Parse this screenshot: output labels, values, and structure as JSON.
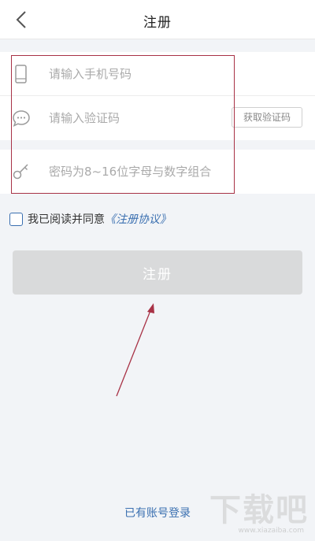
{
  "header": {
    "title": "注册"
  },
  "form": {
    "phone_placeholder": "请输入手机号码",
    "code_placeholder": "请输入验证码",
    "get_code_label": "获取验证码",
    "password_placeholder": "密码为8~16位字母与数字组合"
  },
  "agreement": {
    "text": "我已阅读并同意",
    "link": "《注册协议》",
    "checked": false
  },
  "register_button": {
    "label": "注册"
  },
  "login_link": "已有账号登录",
  "watermark": {
    "text": "下载吧",
    "url": "www.xiazaiba.com"
  },
  "icons": [
    "back-arrow-icon",
    "phone-icon",
    "chat-bubble-icon",
    "key-icon"
  ],
  "colors": {
    "accent": "#3a6fb0",
    "highlight": "#a83246",
    "disabled_button": "#d9dadb",
    "background": "#f2f4f7"
  }
}
